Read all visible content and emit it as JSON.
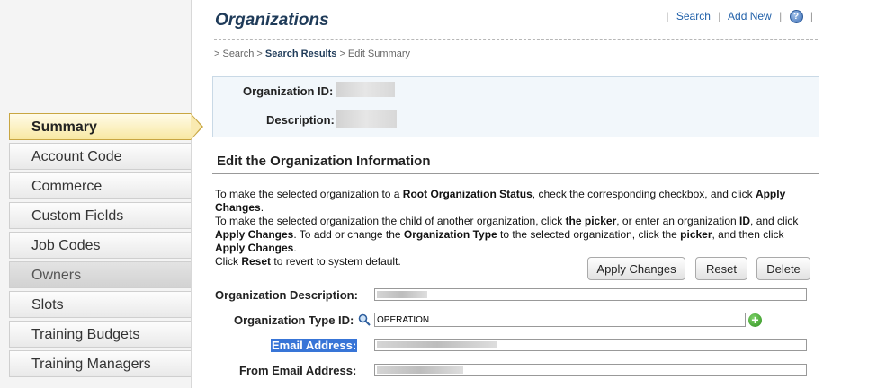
{
  "sidebar": {
    "items": [
      {
        "label": "Summary"
      },
      {
        "label": "Account Code"
      },
      {
        "label": "Commerce"
      },
      {
        "label": "Custom Fields"
      },
      {
        "label": "Job Codes"
      },
      {
        "label": "Owners"
      },
      {
        "label": "Slots"
      },
      {
        "label": "Training Budgets"
      },
      {
        "label": "Training Managers"
      }
    ]
  },
  "header": {
    "title": "Organizations",
    "links": {
      "search": "Search",
      "add_new": "Add New",
      "help": "?"
    }
  },
  "breadcrumb": {
    "search": "> Search >",
    "results": "Search Results",
    "current": "> Edit Summary"
  },
  "info": {
    "org_id_label": "Organization ID:",
    "description_label": "Description:"
  },
  "edit": {
    "title": "Edit the Organization Information",
    "instructions": {
      "p1a": "To make the selected organization to a ",
      "p1b": "Root Organization Status",
      "p1c": ", check the corresponding checkbox, and click ",
      "p1d": "Apply Changes",
      "p1e": ".",
      "p2a": "To make the selected organization the child of another organization, click ",
      "p2b": "the picker",
      "p2c": ", or enter an organization ",
      "p2d": "ID",
      "p2e": ", and click ",
      "p2f": "Apply Changes",
      "p2g": ". To add or change the ",
      "p2h": "Organization Type",
      "p2i": " to the selected organization, click the ",
      "p2j": "picker",
      "p2k": ", and then click ",
      "p2l": "Apply Changes",
      "p2m": ".",
      "p3a": "Click ",
      "p3b": "Reset",
      "p3c": " to revert to system default."
    },
    "buttons": {
      "apply": "Apply Changes",
      "reset": "Reset",
      "delete": "Delete"
    },
    "fields": {
      "org_description_label": "Organization Description:",
      "org_description_value": "",
      "org_type_label": "Organization Type ID:",
      "org_type_value": "OPERATION",
      "email_label": "Email Address:",
      "email_value": "",
      "from_email_label": "From Email Address:",
      "from_email_value": ""
    }
  },
  "colors": {
    "accent": "#1f3b59",
    "active_tab": "#f8e8a2",
    "selection": "#3875d7"
  }
}
